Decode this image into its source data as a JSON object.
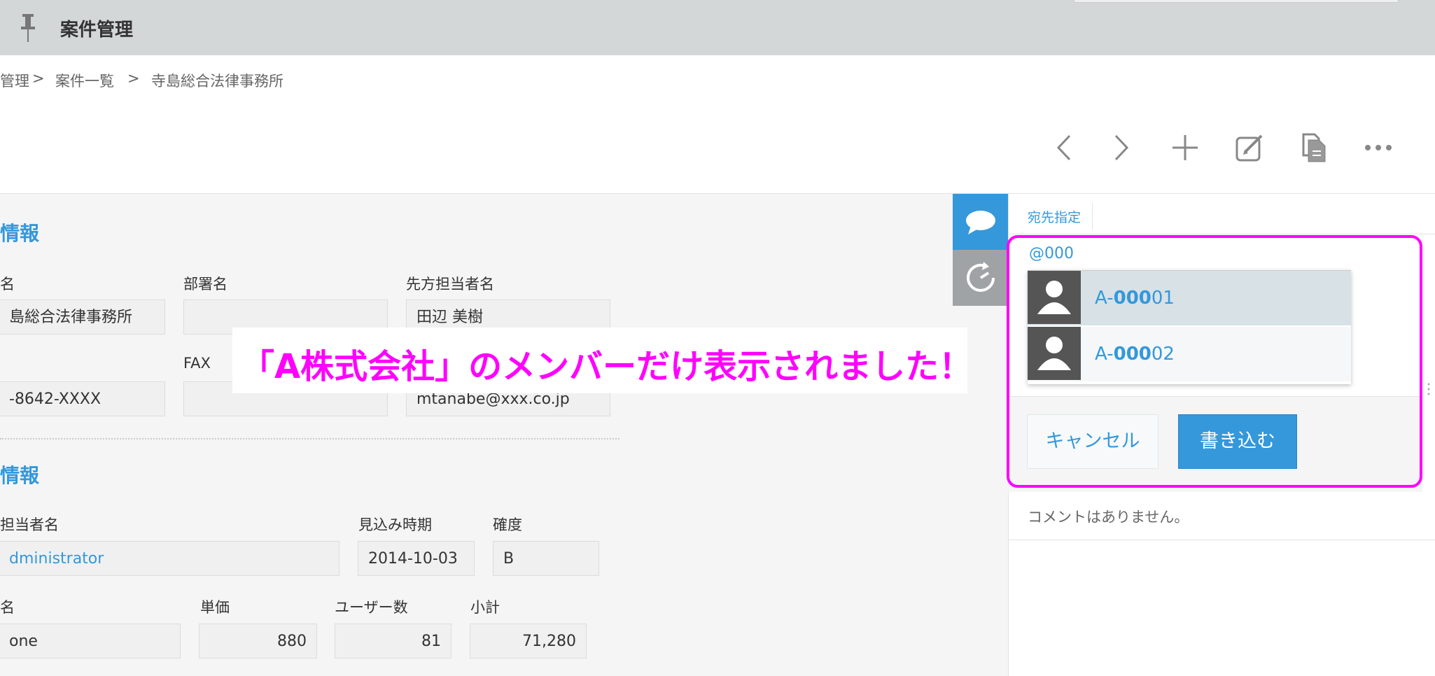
{
  "header": {
    "title": "案件管理"
  },
  "breadcrumb": {
    "item1": "管理",
    "sep1": ">",
    "item2": "案件一覧",
    "sep2": ">",
    "item3": "寺島総合法律事務所"
  },
  "toolbar": {
    "prev_icon": "chevron-left-icon",
    "next_icon": "chevron-right-icon",
    "add_icon": "plus-icon",
    "edit_icon": "pencil-square-icon",
    "duplicate_icon": "document-copy-icon",
    "more_icon": "more-dots-icon"
  },
  "section1": {
    "title": "情報",
    "company_label": "名",
    "company_value": "島総合法律事務所",
    "dept_label": "部署名",
    "dept_value": "",
    "contact_label": "先方担当者名",
    "contact_value": "田辺 美樹",
    "tel_value": "-8642-XXXX",
    "fax_label": "FAX",
    "fax_value": "",
    "email_value": "mtanabe@xxx.co.jp"
  },
  "section2": {
    "title": "情報",
    "owner_label": "担当者名",
    "owner_value": "dministrator",
    "forecast_label": "見込み時期",
    "forecast_value": "2014-10-03",
    "certainty_label": "確度",
    "certainty_value": "B",
    "product_label": "名",
    "product_value": "one",
    "price_label": "単価",
    "price_value": "880",
    "users_label": "ユーザー数",
    "users_value": "81",
    "subtotal_label": "小計",
    "subtotal_value": "71,280"
  },
  "side_tabs": {
    "comments_icon": "speech-bubble-icon",
    "history_icon": "history-clock-icon"
  },
  "comment_panel": {
    "tab_label": "宛先指定",
    "mention_input": "@000",
    "suggestions": [
      {
        "prefix": "A-",
        "match": "000",
        "suffix": "01"
      },
      {
        "prefix": "A-",
        "match": "000",
        "suffix": "02"
      }
    ],
    "cancel_label": "キャンセル",
    "post_label": "書き込む",
    "empty_message": "コメントはありません。"
  },
  "annotation": {
    "text": "「A株式会社」のメンバーだけ表示されました！"
  },
  "colors": {
    "accent": "#3498db",
    "highlight": "#ff00ff",
    "header_bg": "#d3d7d8"
  }
}
